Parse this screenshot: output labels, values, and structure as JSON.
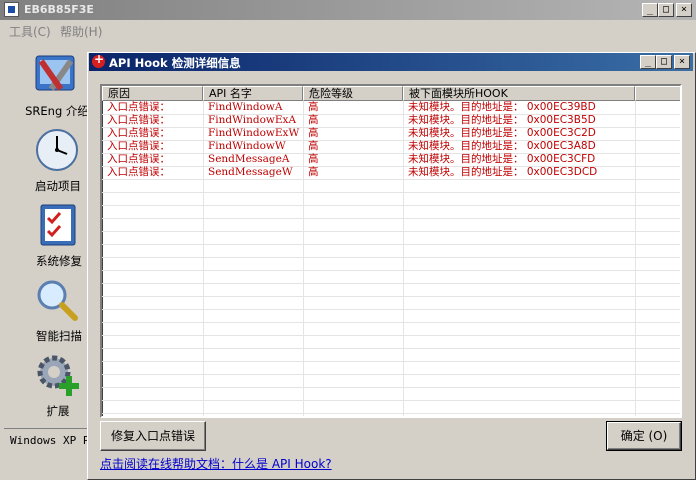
{
  "main_window": {
    "title": "EB6B85F3E",
    "menu": [
      "工具(C)",
      "帮助(H)"
    ]
  },
  "sidebar": {
    "items": [
      {
        "label": "SREng 介绍",
        "icon": "tools-icon"
      },
      {
        "label": "启动项目",
        "icon": "clock-icon"
      },
      {
        "label": "系统修复",
        "icon": "checklist-icon"
      },
      {
        "label": "智能扫描",
        "icon": "magnifier-icon"
      },
      {
        "label": "扩展",
        "icon": "gear-plus-icon"
      }
    ],
    "status": "Windows XP P"
  },
  "dialog": {
    "title": "API Hook 检测详细信息",
    "columns": [
      "原因",
      "API 名字",
      "危险等级",
      "被下面模块所HOOK"
    ],
    "rows": [
      {
        "reason": "入口点错误：",
        "api": "FindWindowA",
        "level": "高",
        "module": "未知模块。目的地址是： 0x00EC39BD"
      },
      {
        "reason": "入口点错误：",
        "api": "FindWindowExA",
        "level": "高",
        "module": "未知模块。目的地址是： 0x00EC3B5D"
      },
      {
        "reason": "入口点错误：",
        "api": "FindWindowExW",
        "level": "高",
        "module": "未知模块。目的地址是： 0x00EC3C2D"
      },
      {
        "reason": "入口点错误：",
        "api": "FindWindowW",
        "level": "高",
        "module": "未知模块。目的地址是： 0x00EC3A8D"
      },
      {
        "reason": "入口点错误：",
        "api": "SendMessageA",
        "level": "高",
        "module": "未知模块。目的地址是： 0x00EC3CFD"
      },
      {
        "reason": "入口点错误：",
        "api": "SendMessageW",
        "level": "高",
        "module": "未知模块。目的地址是： 0x00EC3DCD"
      }
    ],
    "fix_button": "修复入口点错误",
    "ok_button": "确定 (O)",
    "help_link": "点击阅读在线帮助文档：什么是 API Hook?"
  },
  "colors": {
    "row_text": "#c00000",
    "title_active": "#0a246a",
    "link": "#0000cc"
  }
}
